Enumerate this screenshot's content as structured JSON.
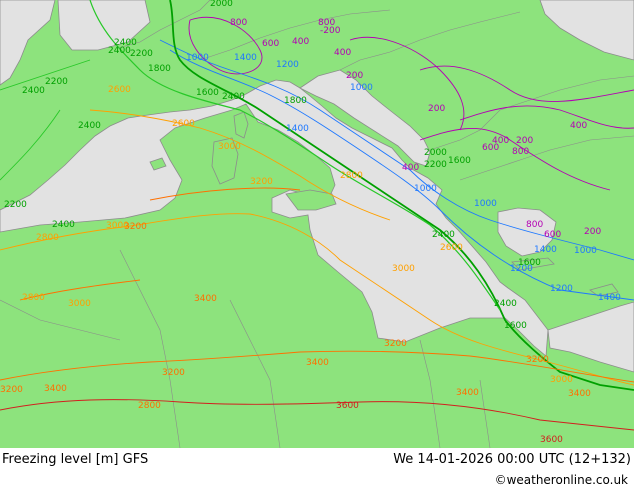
{
  "footer": {
    "title": "Freezing level [m] GFS",
    "datetime": "We 14-01-2026 00:00 UTC (12+132)",
    "credit": "©weatheronline.co.uk"
  },
  "colors": {
    "land": "#8de37d",
    "sea": "#e2e2e2",
    "coast": "#8c8c8c",
    "c400_800": "#b400b4",
    "c1000_1400": "#1e78ff",
    "c1600_2000": "#00a000",
    "c2200_2400": "#28c828",
    "c2600_3000": "#ffa000",
    "c3200_3400": "#ff7000",
    "c3600": "#d21e1e"
  },
  "contour_labels": [
    {
      "text": "2000"
    },
    {
      "text": "800"
    },
    {
      "text": "800"
    },
    {
      "text": "-200"
    },
    {
      "text": "2400"
    },
    {
      "text": "2400"
    },
    {
      "text": "2200"
    },
    {
      "text": "1800"
    },
    {
      "text": "1000"
    },
    {
      "text": "1400"
    },
    {
      "text": "1200"
    },
    {
      "text": "600"
    },
    {
      "text": "400"
    },
    {
      "text": "400"
    },
    {
      "text": "200"
    },
    {
      "text": "2200"
    },
    {
      "text": "2400"
    },
    {
      "text": "2600"
    },
    {
      "text": "2400"
    },
    {
      "text": "1600"
    },
    {
      "text": "2400"
    },
    {
      "text": "1800"
    },
    {
      "text": "1400"
    },
    {
      "text": "200"
    },
    {
      "text": "400"
    },
    {
      "text": "200"
    },
    {
      "text": "400"
    },
    {
      "text": "600"
    },
    {
      "text": "800"
    },
    {
      "text": "400"
    },
    {
      "text": "2000"
    },
    {
      "text": "2200"
    },
    {
      "text": "1600"
    },
    {
      "text": "1000"
    },
    {
      "text": "2800"
    },
    {
      "text": "3000"
    },
    {
      "text": "3200"
    },
    {
      "text": "2600"
    },
    {
      "text": "2200"
    },
    {
      "text": "2400"
    },
    {
      "text": "3000"
    },
    {
      "text": "3200"
    },
    {
      "text": "2800"
    },
    {
      "text": "2800"
    },
    {
      "text": "3000"
    },
    {
      "text": "3400"
    },
    {
      "text": "3000"
    },
    {
      "text": "2600"
    },
    {
      "text": "800"
    },
    {
      "text": "1000"
    },
    {
      "text": "200"
    },
    {
      "text": "600"
    },
    {
      "text": "1400"
    },
    {
      "text": "1200"
    },
    {
      "text": "1600"
    },
    {
      "text": "1000"
    },
    {
      "text": "1200"
    },
    {
      "text": "1400"
    },
    {
      "text": "2400"
    },
    {
      "text": "1600"
    },
    {
      "text": "3200"
    },
    {
      "text": "3200"
    },
    {
      "text": "3400"
    },
    {
      "text": "3400"
    },
    {
      "text": "3200"
    },
    {
      "text": "3000"
    },
    {
      "text": "3400"
    },
    {
      "text": "3600"
    },
    {
      "text": "3400"
    },
    {
      "text": "3200"
    },
    {
      "text": "3600"
    },
    {
      "text": "2800"
    },
    {
      "text": "2400"
    },
    {
      "text": "1000"
    }
  ]
}
